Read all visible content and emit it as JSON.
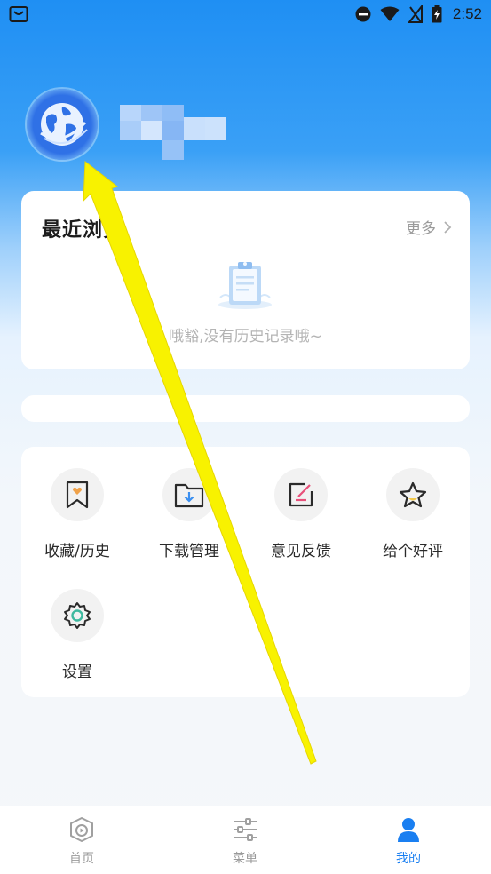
{
  "status_bar": {
    "time": "2:52",
    "icons": [
      "bag-icon",
      "dnd-icon",
      "wifi-icon",
      "no-signal-icon",
      "battery-charging-icon"
    ]
  },
  "profile": {
    "avatar_icon": "globe-icon"
  },
  "recent": {
    "title": "最近浏览",
    "more_label": "更多",
    "empty_text": "哦豁,没有历史记录哦~",
    "empty_icon": "clipboard-icon"
  },
  "tools": [
    {
      "label": "收藏/历史",
      "icon": "bookmark-heart-icon"
    },
    {
      "label": "下载管理",
      "icon": "folder-download-icon"
    },
    {
      "label": "意见反馈",
      "icon": "edit-feedback-icon"
    },
    {
      "label": "给个好评",
      "icon": "star-icon"
    },
    {
      "label": "设置",
      "icon": "gear-icon"
    }
  ],
  "tabs": [
    {
      "label": "首页",
      "icon": "home-play-icon",
      "active": false
    },
    {
      "label": "菜单",
      "icon": "sliders-icon",
      "active": false
    },
    {
      "label": "我的",
      "icon": "user-icon",
      "active": true
    }
  ],
  "colors": {
    "accent": "#1a7ff1",
    "header_blue": "#1f8ff3",
    "annotation_arrow": "#f8f200"
  }
}
